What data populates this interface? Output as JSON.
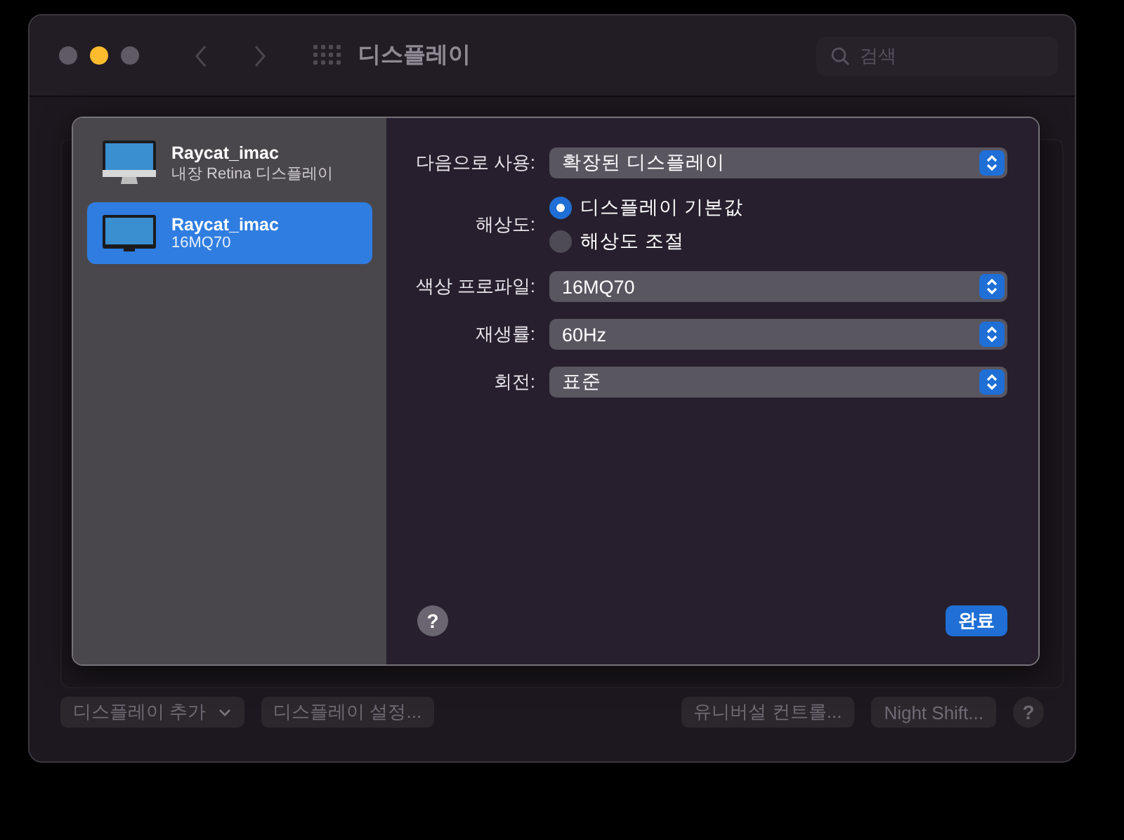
{
  "window": {
    "title": "디스플레이"
  },
  "search": {
    "placeholder": "검색"
  },
  "displays": [
    {
      "kind": "imac",
      "name": "Raycat_imac",
      "subtitle": "내장 Retina 디스플레이",
      "selected": false
    },
    {
      "kind": "monitor",
      "name": "Raycat_imac",
      "subtitle": "16MQ70",
      "selected": true
    }
  ],
  "settings": [
    {
      "kind": "popup",
      "label": "다음으로 사용:",
      "value": "확장된 디스플레이"
    },
    {
      "kind": "radio",
      "label": "해상도:",
      "options": [
        {
          "label": "디스플레이 기본값",
          "selected": true
        },
        {
          "label": "해상도 조절",
          "selected": false
        }
      ]
    },
    {
      "kind": "popup",
      "label": "색상 프로파일:",
      "value": "16MQ70"
    },
    {
      "kind": "popup",
      "label": "재생률:",
      "value": "60Hz"
    },
    {
      "kind": "popup",
      "label": "회전:",
      "value": "표준"
    }
  ],
  "sheet_help": "?",
  "done_button": "완료",
  "footer_buttons": [
    {
      "kind": "menu",
      "label": "디스플레이 추가"
    },
    {
      "kind": "plain",
      "label": "디스플레이 설정..."
    },
    {
      "kind": "spacer"
    },
    {
      "kind": "plain",
      "label": "유니버설 컨트롤..."
    },
    {
      "kind": "plain",
      "label": "Night Shift..."
    },
    {
      "kind": "help",
      "label": "?"
    }
  ]
}
